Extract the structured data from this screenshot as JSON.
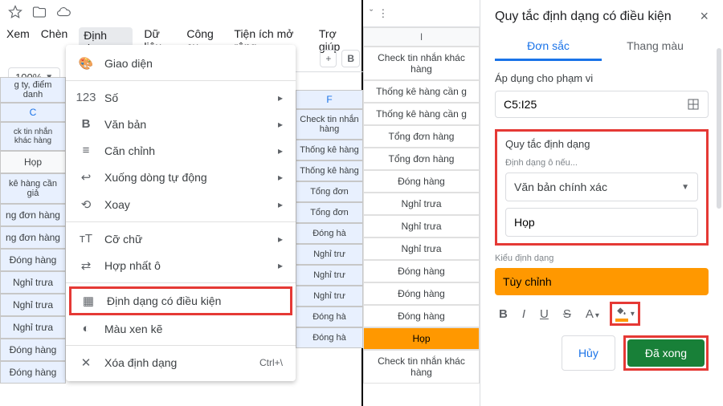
{
  "menubar": {
    "view": "Xem",
    "insert": "Chèn",
    "format": "Định dạng",
    "data": "Dữ liệu",
    "tools": "Công cụ",
    "extensions": "Tiện ích mở rộng",
    "help": "Trợ giúp"
  },
  "zoom": "100%",
  "left_col": {
    "label": "g ty, điểm danh",
    "header": "C",
    "r1": "ck tin nhắn khác hàng",
    "hop": "Họp",
    "r2": "kê hàng cần giả",
    "r3": "ng đơn hàng",
    "r4": "ng đơn hàng",
    "r5": "Đóng hàng",
    "r6": "Nghỉ trưa",
    "r7": "Nghỉ trưa",
    "r8": "Nghỉ trưa",
    "r9": "Đóng hàng",
    "r10": "Đóng hàng"
  },
  "format_menu": {
    "theme": "Giao diện",
    "number": "Số",
    "text": "Văn bản",
    "align": "Căn chỉnh",
    "wrap": "Xuống dòng tự động",
    "rotate": "Xoay",
    "fontsize": "Cỡ chữ",
    "merge": "Hợp nhất ô",
    "conditional": "Định dạng có điều kiện",
    "altcolor": "Màu xen kẽ",
    "clear": "Xóa định dạng",
    "clear_sc": "Ctrl+\\"
  },
  "mid_col": {
    "header": "F",
    "r1": "Check tin nhắn hàng",
    "r2": "Thống kê hàng",
    "r3": "Thống kê hàng",
    "r4": "Tổng đơn",
    "r5": "Tổng đơn",
    "r6": "Đóng hà",
    "r7": "Nghỉ trư",
    "r8": "Nghỉ trư",
    "r9": "Nghỉ trư",
    "r10": "Đóng hà",
    "r11": "Đóng hà"
  },
  "right_col": {
    "header": "I",
    "cells": [
      "Check tin nhắn khác hàng",
      "Thống kê hàng cần g",
      "Thống kê hàng cần g",
      "Tổng đơn hàng",
      "Tổng đơn hàng",
      "Đóng hàng",
      "Nghỉ trưa",
      "Nghỉ trưa",
      "Nghỉ trưa",
      "Đóng hàng",
      "Đóng hàng",
      "Đóng hàng",
      "Họp",
      "Check tin nhắn khác hàng"
    ]
  },
  "sidepanel": {
    "title": "Quy tắc định dạng có điều kiện",
    "tab1": "Đơn sắc",
    "tab2": "Thang màu",
    "apply_label": "Áp dụng cho phạm vi",
    "range": "C5:I25",
    "rule_heading": "Quy tắc định dạng",
    "rule_sub": "Định dạng ô nếu...",
    "rule_select": "Văn bản chính xác",
    "rule_value": "Họp",
    "style_label": "Kiểu định dạng",
    "style_preview": "Tùy chỉnh",
    "cancel": "Hủy",
    "done": "Đã xong"
  },
  "fmt": {
    "bold": "B",
    "italic": "I",
    "underline": "U",
    "strike": "S",
    "textcolor": "A"
  }
}
